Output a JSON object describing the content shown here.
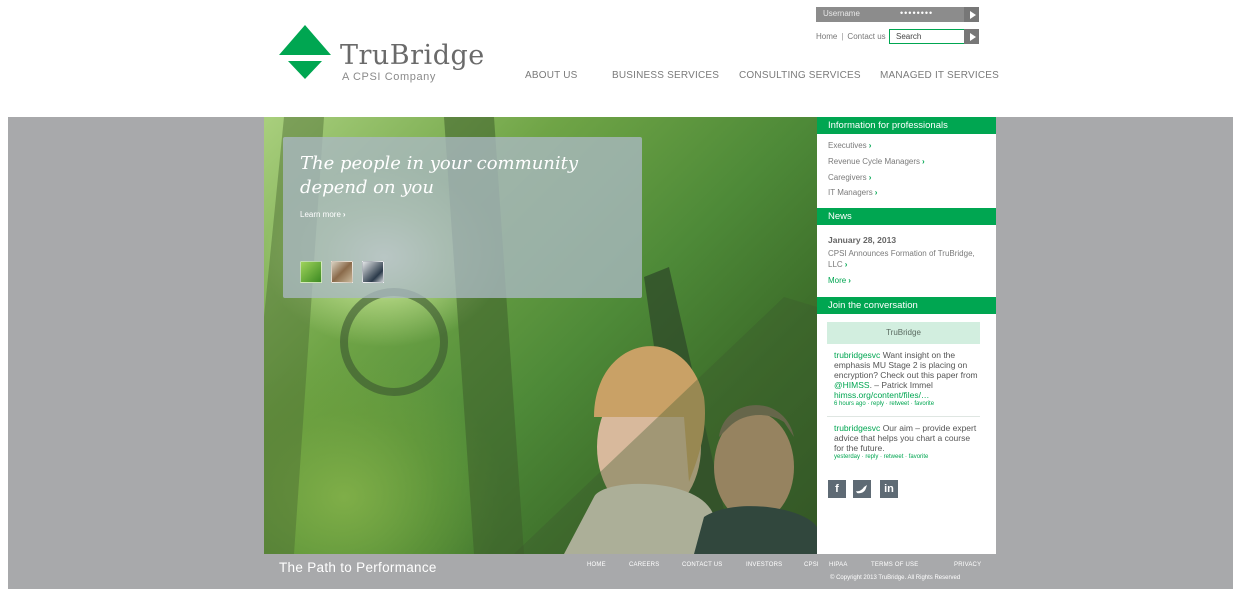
{
  "brand": {
    "name": "TruBridge",
    "tagline_sub": "A CPSI Company",
    "accent_color": "#00a651"
  },
  "header": {
    "login": {
      "username_placeholder": "Username",
      "password_mask": "••••••••"
    },
    "util_links": [
      "Home",
      "Contact us"
    ],
    "search": {
      "placeholder": "Search"
    },
    "nav": [
      "ABOUT US",
      "BUSINESS SERVICES",
      "CONSULTING SERVICES",
      "MANAGED IT SERVICES"
    ]
  },
  "hero": {
    "headline": "The people in your community depend on you",
    "learn_more": "Learn more"
  },
  "sidebar": {
    "professionals": {
      "title": "Information for professionals",
      "links": [
        "Executives",
        "Revenue Cycle Managers",
        "Caregivers",
        "IT Managers"
      ]
    },
    "news": {
      "title": "News",
      "date": "January 28, 2013",
      "headline": "CPSI Announces Formation of TruBridge, LLC",
      "more": "More"
    },
    "conversation": {
      "title": "Join the conversation",
      "feed_title": "TruBridge",
      "tweets": [
        {
          "handle": "trubridgesvc",
          "text": "Want insight on the emphasis MU Stage 2 is placing on encryption? Check out this paper from",
          "mention": "@HIMSS",
          "text2": ". – Patrick Immel",
          "link": "himss.org/content/files/…",
          "meta": "6 hours ago · reply · retweet · favorite"
        },
        {
          "handle": "trubridgesvc",
          "text": "Our aim – provide expert advice that helps you chart a course for the future.",
          "meta": "yesterday · reply · retweet · favorite"
        }
      ],
      "social": [
        "facebook-icon",
        "twitter-icon",
        "linkedin-icon"
      ]
    }
  },
  "footer": {
    "tagline": "The Path to Performance",
    "nav": [
      "HOME",
      "CAREERS",
      "CONTACT US",
      "INVESTORS",
      "CPSI",
      "HIPAA",
      "TERMS OF USE",
      "PRIVACY"
    ],
    "copyright": "© Copyright 2013 TruBridge. All Rights Reserved"
  }
}
